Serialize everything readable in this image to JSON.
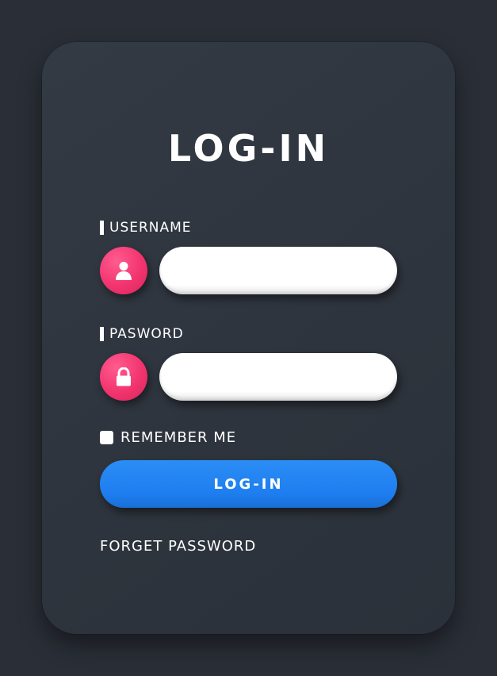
{
  "form": {
    "title": "LOG-IN",
    "username": {
      "label": "USERNAME",
      "value": "",
      "placeholder": "",
      "icon": "user-icon"
    },
    "password": {
      "label": "PASWORD",
      "value": "",
      "placeholder": "",
      "icon": "lock-icon"
    },
    "remember_label": "REMEMBER ME",
    "remember_checked": false,
    "submit_label": "LOG-IN",
    "forgot_label": "FORGET PASSWORD"
  },
  "colors": {
    "background": "#2a2f37",
    "card": "#30363f",
    "icon_accent": "#f2346f",
    "button_accent": "#1e7ef0",
    "text": "#ffffff"
  }
}
